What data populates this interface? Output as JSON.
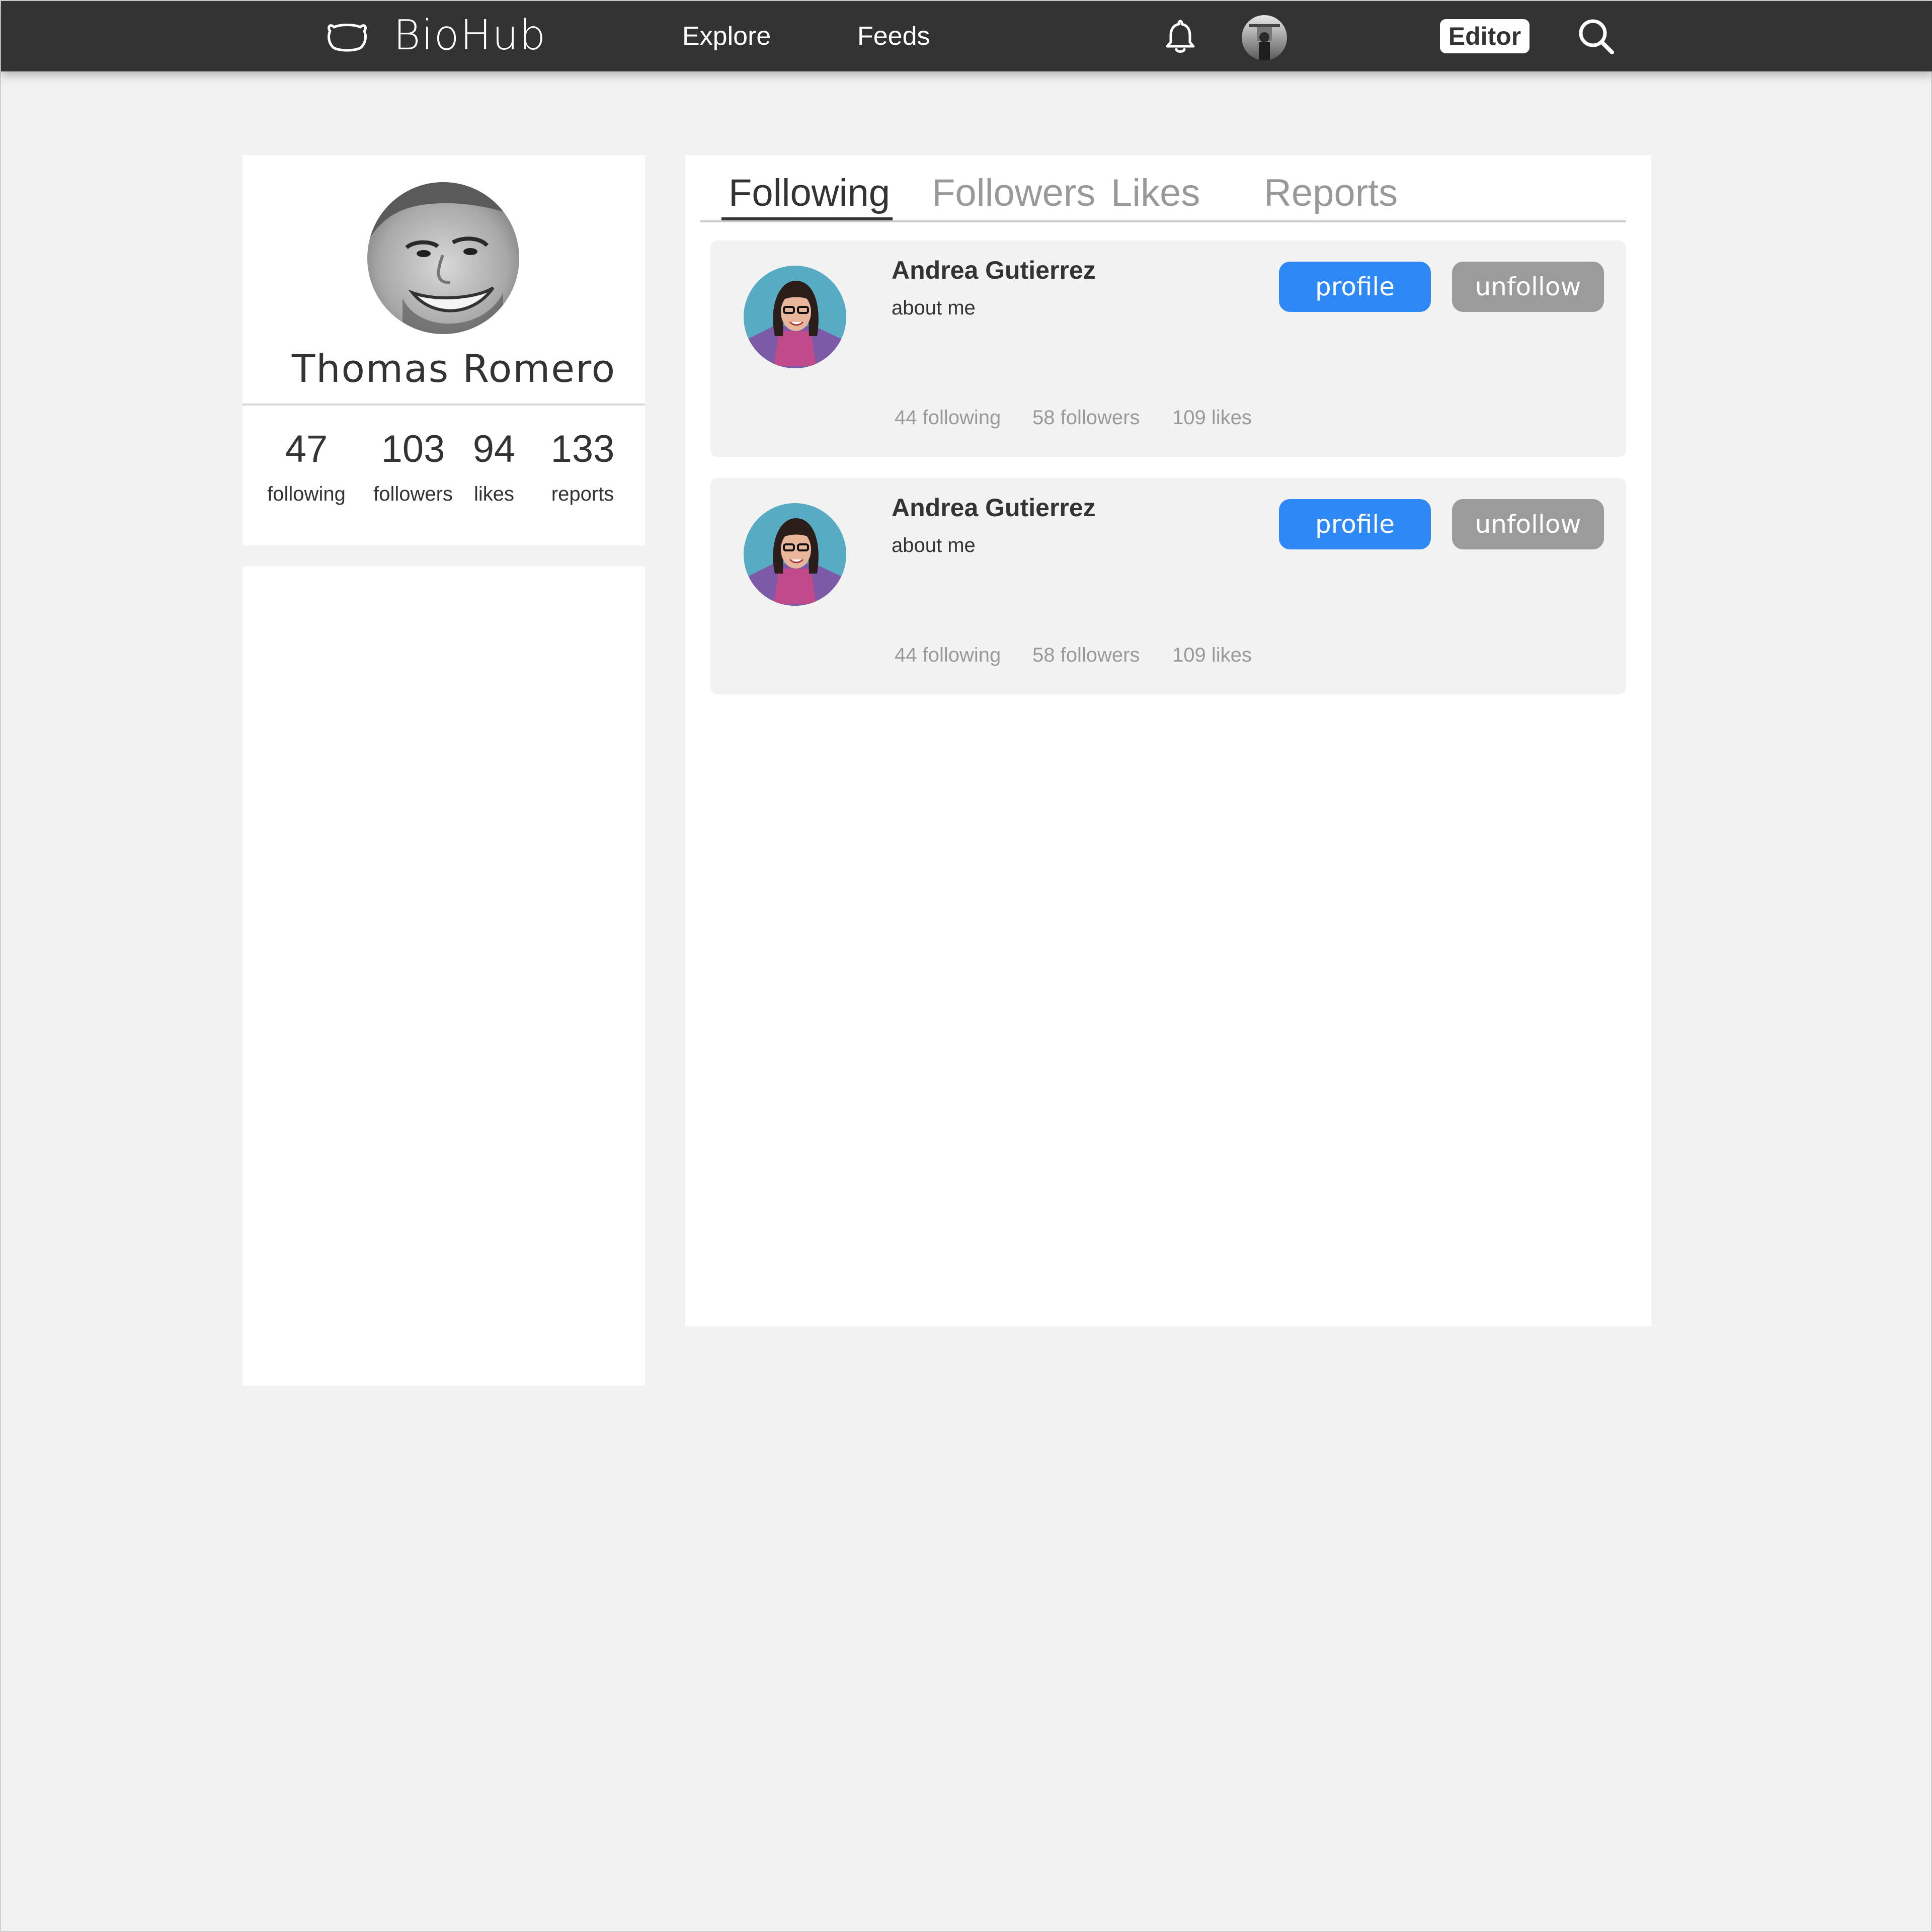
{
  "nav": {
    "brand": "BioHub",
    "links": [
      {
        "label": "Explore"
      },
      {
        "label": "Feeds"
      }
    ],
    "editor_label": "Editor",
    "icons": {
      "logo": "bear-head-icon",
      "notifications": "bell-icon",
      "search": "search-icon"
    }
  },
  "profile": {
    "name": "Thomas Romero",
    "stats": [
      {
        "value": "47",
        "label": "following"
      },
      {
        "value": "103",
        "label": "followers"
      },
      {
        "value": "94",
        "label": "likes"
      },
      {
        "value": "133",
        "label": "reports"
      }
    ]
  },
  "tabs": [
    {
      "label": "Following",
      "active": true
    },
    {
      "label": "Followers",
      "active": false
    },
    {
      "label": "Likes",
      "active": false
    },
    {
      "label": "Reports",
      "active": false
    }
  ],
  "users": [
    {
      "name": "Andrea Gutierrez",
      "about": "about me",
      "profile_label": "profile",
      "unfollow_label": "unfollow",
      "following": "44 following",
      "followers": "58 followers",
      "likes": "109 likes"
    },
    {
      "name": "Andrea Gutierrez",
      "about": "about me",
      "profile_label": "profile",
      "unfollow_label": "unfollow",
      "following": "44 following",
      "followers": "58 followers",
      "likes": "109 likes"
    }
  ],
  "colors": {
    "topbar": "#333333",
    "background": "#f2f2f2",
    "primary_button": "#2e89f7",
    "secondary_button": "#9b9b9b",
    "muted_text": "#999999"
  }
}
